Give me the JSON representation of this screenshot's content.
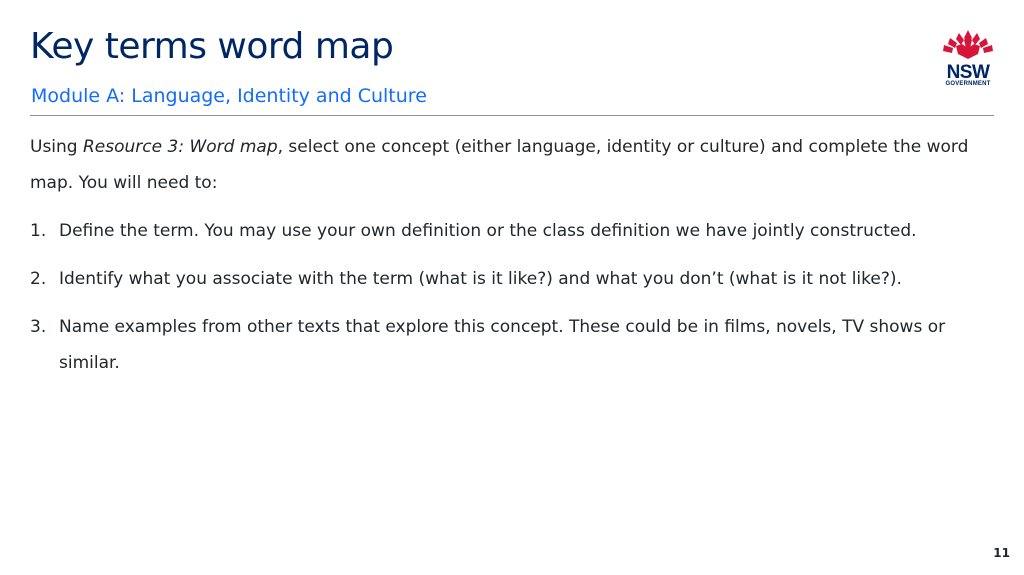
{
  "header": {
    "title": "Key terms word map",
    "subtitle": "Module A: Language, Identity and Culture"
  },
  "logo": {
    "wordmark": "NSW",
    "label": "GOVERNMENT",
    "petal_color": "#d7153a",
    "text_color": "#002664"
  },
  "intro": {
    "part1": "Using ",
    "emphasis": "Resource 3: Word map",
    "part2": ", select one concept (either language, identity or culture) and complete the word map. You will need to:"
  },
  "steps": [
    {
      "number": "1.",
      "text": "Define the term. You may use your own definition or the class definition we have jointly constructed."
    },
    {
      "number": "2.",
      "text": "Identify what you associate with the term (what is it like?) and what you don’t (what is it not like?)."
    },
    {
      "number": "3.",
      "text": "Name examples from other texts that explore this concept. These could be in films, novels, TV shows or similar."
    }
  ],
  "footer": {
    "page_number": "11"
  }
}
